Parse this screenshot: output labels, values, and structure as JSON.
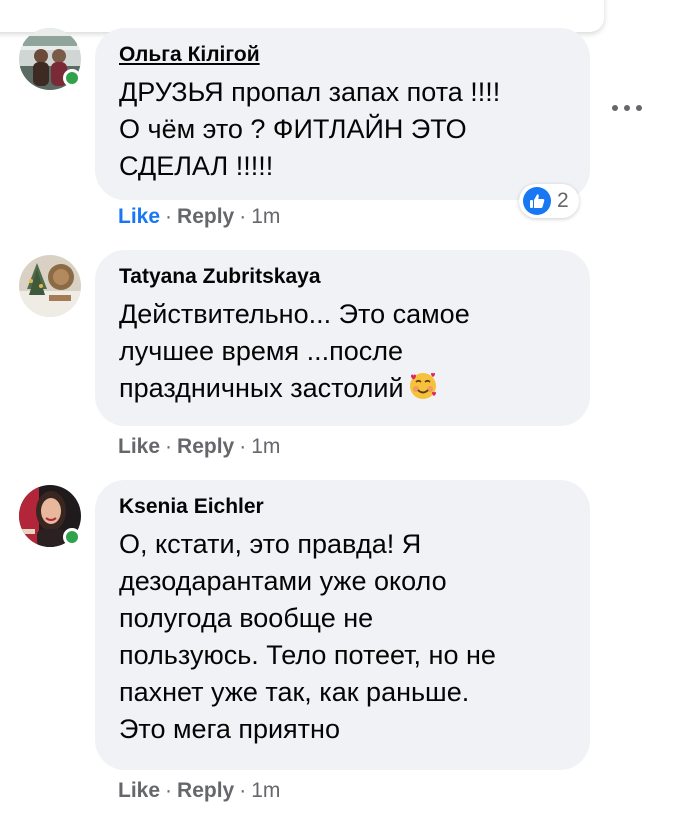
{
  "comments": [
    {
      "author": "Ольга Кiлiгой",
      "text": "ДРУЗЬЯ пропал запах пота !!!!\nО чём это ? ФИТЛАЙН ЭТО\nСДЕЛАЛ !!!!!",
      "like_label": "Like",
      "reply_label": "Reply",
      "time": "1m",
      "online": true,
      "reaction_count": "2"
    },
    {
      "author": "Tatyana Zubritskaya",
      "text": "Действительно... Это самое\nлучшее время ...после\nпраздничных застолий",
      "emoji": "smiling-face-with-hearts",
      "like_label": "Like",
      "reply_label": "Reply",
      "time": "1m",
      "online": false
    },
    {
      "author": "Ksenia Eichler",
      "text": "О, кстати, это правда! Я\nдезодарантами уже около\nполугода вообще не\nпользуюсь. Тело потеет, но не\nпахнет уже так, как раньше.\nЭто мега приятно",
      "like_label": "Like",
      "reply_label": "Reply",
      "time": "1m",
      "online": true
    }
  ],
  "colors": {
    "bubble": "#f0f2f5",
    "meta_text": "#65676b",
    "like_active": "#1877f2",
    "online": "#31a24c"
  },
  "icons": [
    "more-options-icon",
    "like-reaction-icon",
    "smiling-face-with-hearts-icon"
  ]
}
